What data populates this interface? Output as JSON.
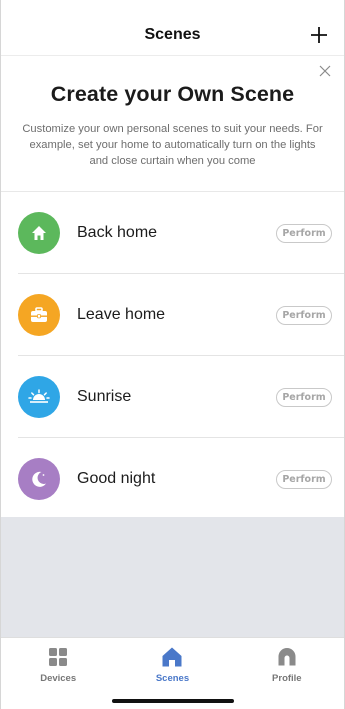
{
  "nav": {
    "title": "Scenes",
    "add_icon": "plus-icon"
  },
  "banner": {
    "title": "Create your Own Scene",
    "text": "Customize your own personal scenes to suit your needs. For example, set your home to automatically turn on the lights and close curtain when you come",
    "close_icon": "close-icon"
  },
  "scenes": [
    {
      "label": "Back home",
      "icon": "house-icon",
      "color": "#5cb85c",
      "action": "Perform"
    },
    {
      "label": "Leave home",
      "icon": "briefcase-icon",
      "color": "#f5a623",
      "action": "Perform"
    },
    {
      "label": "Sunrise",
      "icon": "sunrise-icon",
      "color": "#2fa6e6",
      "action": "Perform"
    },
    {
      "label": "Good night",
      "icon": "moon-icon",
      "color": "#a77ec4",
      "action": "Perform"
    }
  ],
  "tabs": [
    {
      "label": "Devices",
      "icon": "grid-icon",
      "active": false
    },
    {
      "label": "Scenes",
      "icon": "house-icon",
      "active": true
    },
    {
      "label": "Profile",
      "icon": "profile-icon",
      "active": false
    }
  ],
  "colors": {
    "accent": "#4a78c9",
    "tab_inactive": "#777777",
    "empty_bg": "#e3e5ea"
  }
}
